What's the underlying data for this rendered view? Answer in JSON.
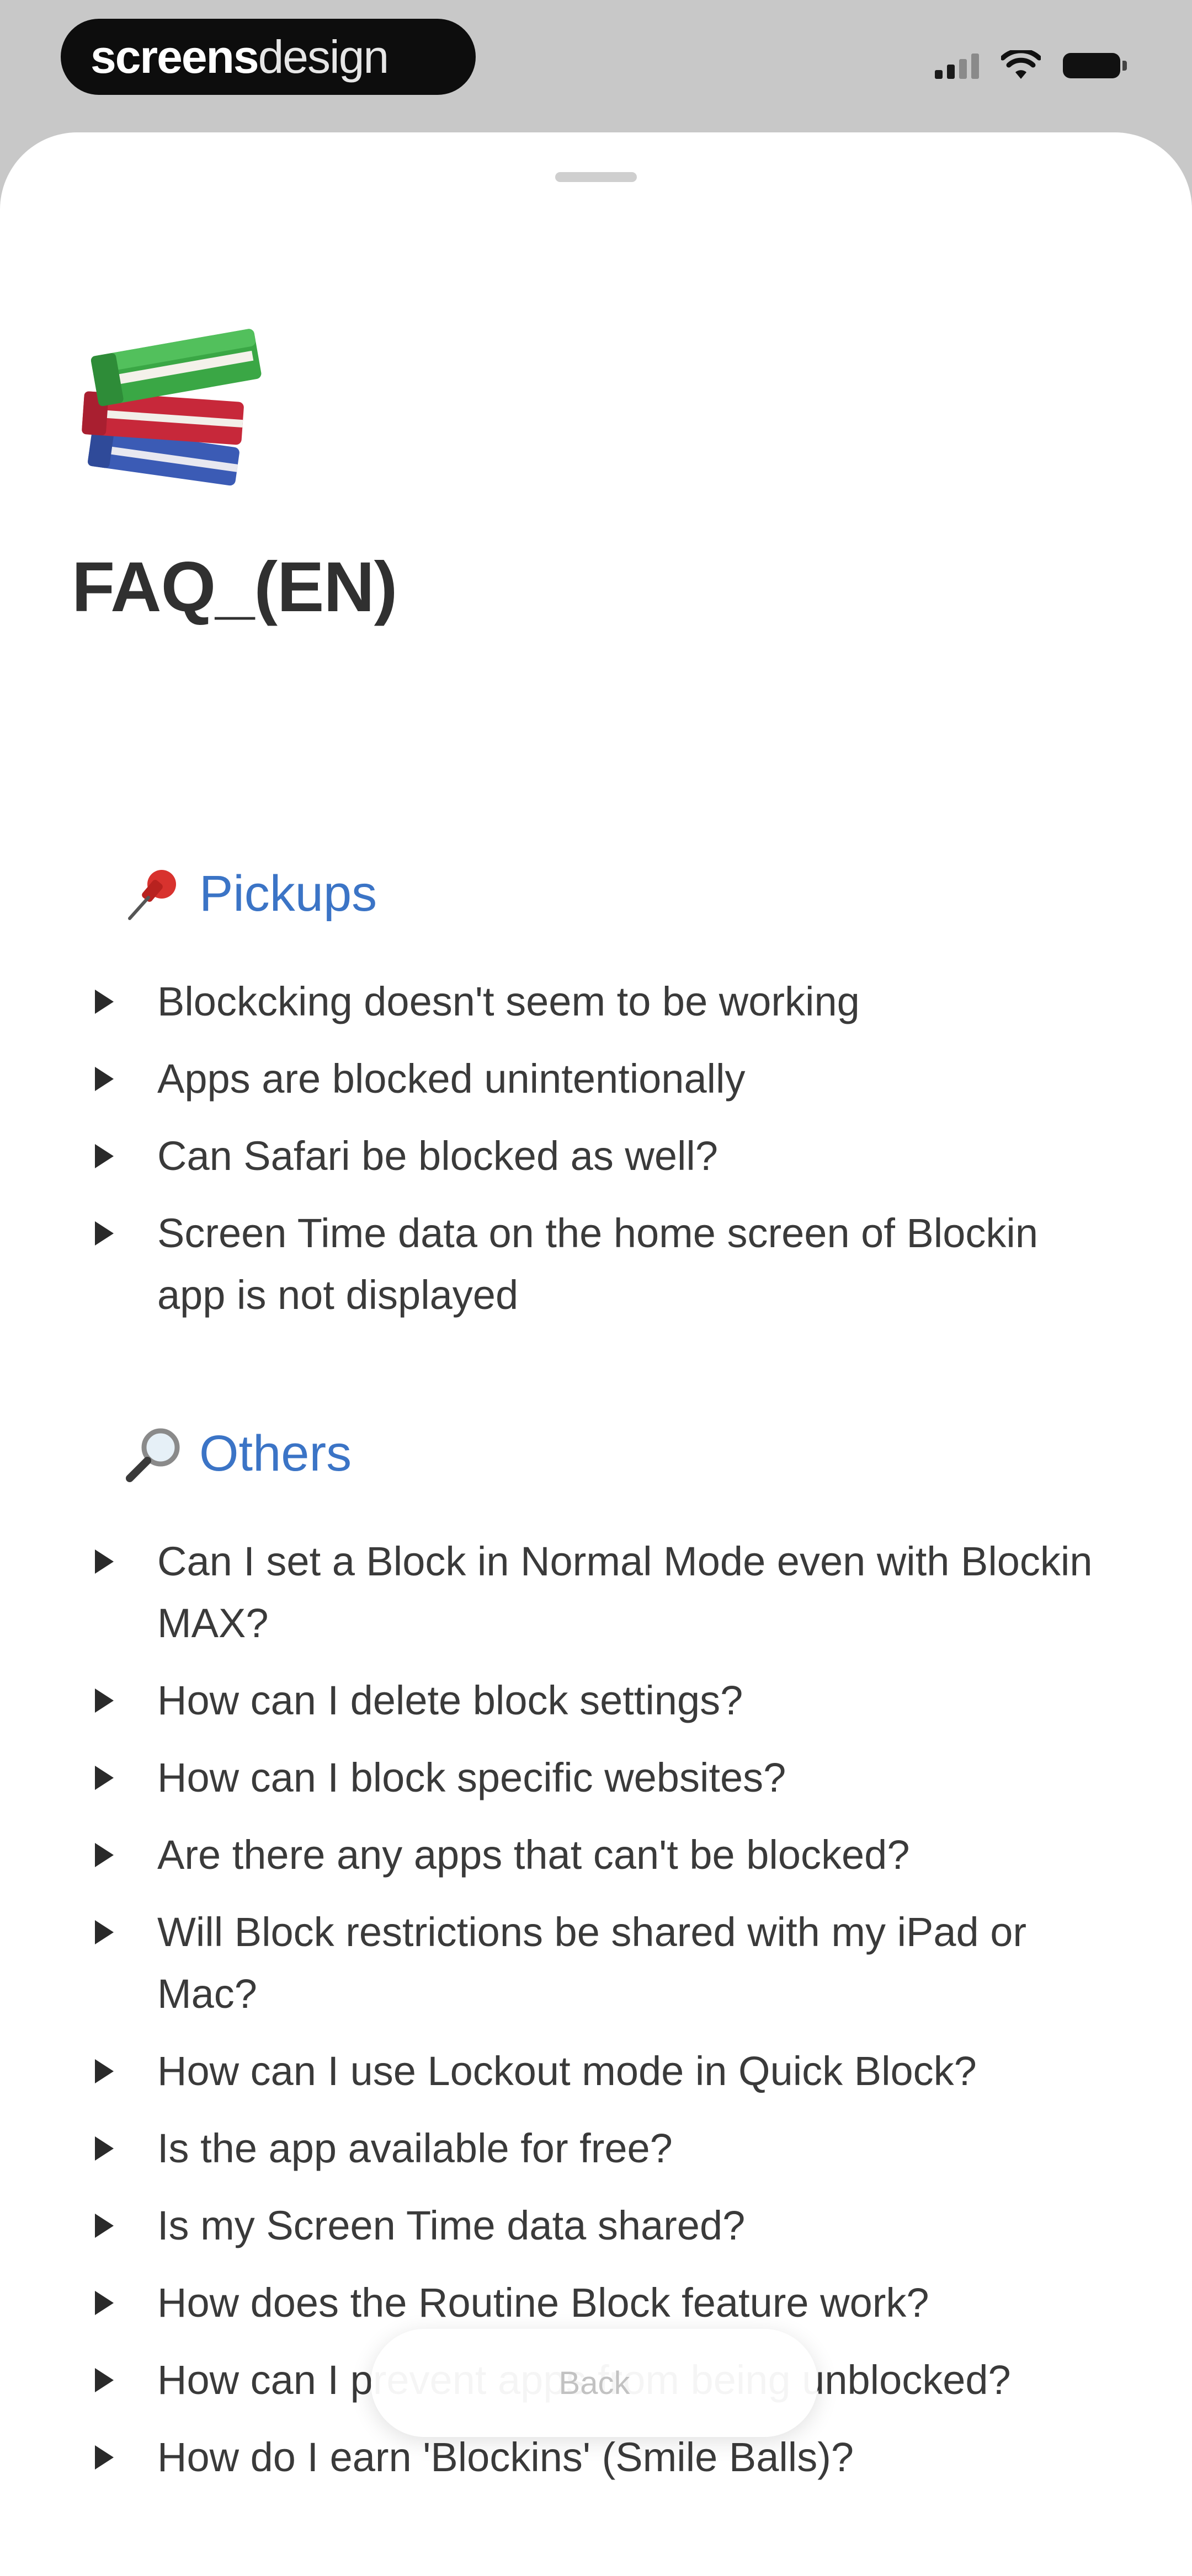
{
  "status_bar": {
    "brand_bold": "screens",
    "brand_light": "design"
  },
  "page": {
    "icon": "books-icon",
    "title": "FAQ_(EN)"
  },
  "sections": [
    {
      "icon": "pushpin-icon",
      "heading": "Pickups",
      "items": [
        "Blockcking doesn't seem to be working",
        "Apps are blocked unintentionally",
        "Can Safari be blocked as well?",
        "Screen Time data on the home screen of Blockin app is not displayed"
      ]
    },
    {
      "icon": "magnifying-glass-icon",
      "heading": "Others",
      "items": [
        "Can I set a Block in Normal Mode even with Blockin MAX?",
        "How can I delete block settings?",
        "How can I block specific websites?",
        "Are there any apps that can't be blocked?",
        "Will Block restrictions be shared with my iPad or Mac?",
        "How can I use Lockout mode in Quick Block?",
        "Is the app available for free?",
        "Is my Screen Time data shared?",
        "How does the Routine Block feature work?",
        "How can I prevent apps from being unblocked?",
        "How do I earn 'Blockins' (Smile Balls)?"
      ]
    }
  ],
  "back_button": {
    "label": "Back"
  },
  "colors": {
    "accent": "#3b74c6",
    "text": "#3a3a3a",
    "background": "#ffffff"
  }
}
